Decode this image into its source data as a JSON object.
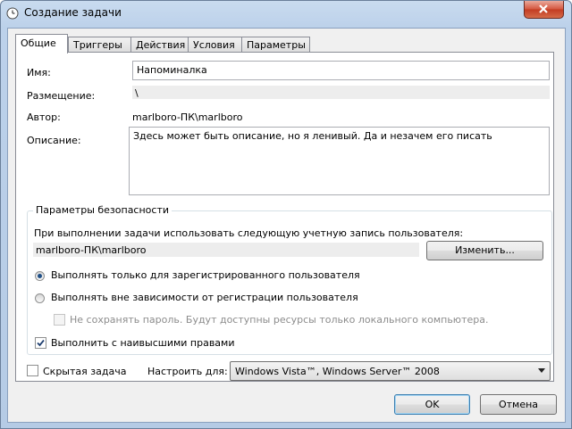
{
  "window": {
    "title": "Создание задачи",
    "close_label": "Close"
  },
  "tabs": [
    {
      "label": "Общие",
      "active": true
    },
    {
      "label": "Триггеры"
    },
    {
      "label": "Действия"
    },
    {
      "label": "Условия"
    },
    {
      "label": "Параметры"
    }
  ],
  "general": {
    "name_label": "Имя:",
    "name_value": "Напоминалка",
    "location_label": "Размещение:",
    "location_value": "\\",
    "author_label": "Автор:",
    "author_value": "marlboro-ПК\\marlboro",
    "description_label": "Описание:",
    "description_value": "Здесь может быть описание, но я ленивый. Да и незачем его писать"
  },
  "security": {
    "group_title": "Параметры безопасности",
    "account_prompt": "При выполнении задачи использовать следующую учетную запись пользователя:",
    "account_value": "marlboro-ПК\\marlboro",
    "change_button": "Изменить...",
    "radio_logged_on": "Выполнять только для зарегистрированного пользователя",
    "radio_any": "Выполнять вне зависимости от регистрации пользователя",
    "no_store_password": "Не сохранять пароль. Будут доступны ресурсы только локального компьютера.",
    "highest_privileges": "Выполнить с наивысшими правами",
    "selected_radio": "logged_on",
    "highest_checked": true,
    "no_store_checked": false
  },
  "bottom": {
    "hidden_task": "Скрытая задача",
    "hidden_checked": false,
    "configure_label": "Настроить для:",
    "configure_value": "Windows Vista™, Windows Server™ 2008"
  },
  "buttons": {
    "ok": "OK",
    "cancel": "Отмена"
  },
  "colors": {
    "accent": "#3c7fb1",
    "close": "#c23b22",
    "frame": "#bcd1ea"
  }
}
